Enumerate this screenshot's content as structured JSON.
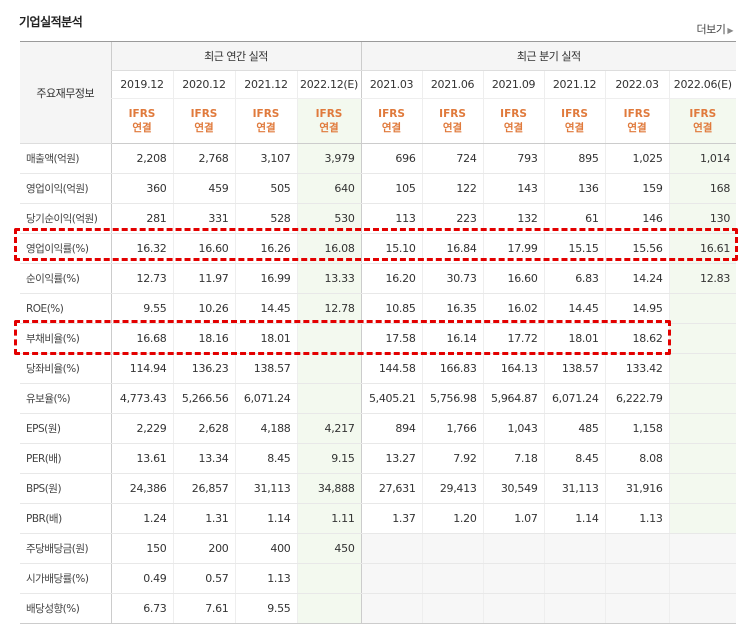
{
  "page": {
    "title": "기업실적분석",
    "more_label": "더보기"
  },
  "header": {
    "row_label": "주요재무정보",
    "annual_label": "최근 연간 실적",
    "quarter_label": "최근 분기 실적",
    "periods": [
      "2019.12",
      "2020.12",
      "2021.12",
      "2022.12(E)",
      "2021.03",
      "2021.06",
      "2021.09",
      "2021.12",
      "2022.03",
      "2022.06(E)"
    ],
    "ifrs_top": "IFRS",
    "ifrs_bottom": "연결"
  },
  "rows": [
    {
      "label": "매출액(억원)",
      "values": [
        "2,208",
        "2,768",
        "3,107",
        "3,979",
        "696",
        "724",
        "793",
        "895",
        "1,025",
        "1,014"
      ]
    },
    {
      "label": "영업이익(억원)",
      "values": [
        "360",
        "459",
        "505",
        "640",
        "105",
        "122",
        "143",
        "136",
        "159",
        "168"
      ]
    },
    {
      "label": "당기순이익(억원)",
      "values": [
        "281",
        "331",
        "528",
        "530",
        "113",
        "223",
        "132",
        "61",
        "146",
        "130"
      ]
    },
    {
      "label": "영업이익률(%)",
      "values": [
        "16.32",
        "16.60",
        "16.26",
        "16.08",
        "15.10",
        "16.84",
        "17.99",
        "15.15",
        "15.56",
        "16.61"
      ]
    },
    {
      "label": "순이익률(%)",
      "values": [
        "12.73",
        "11.97",
        "16.99",
        "13.33",
        "16.20",
        "30.73",
        "16.60",
        "6.83",
        "14.24",
        "12.83"
      ]
    },
    {
      "label": "ROE(%)",
      "values": [
        "9.55",
        "10.26",
        "14.45",
        "12.78",
        "10.85",
        "16.35",
        "16.02",
        "14.45",
        "14.95",
        ""
      ]
    },
    {
      "label": "부채비율(%)",
      "values": [
        "16.68",
        "18.16",
        "18.01",
        "",
        "17.58",
        "16.14",
        "17.72",
        "18.01",
        "18.62",
        ""
      ]
    },
    {
      "label": "당좌비율(%)",
      "values": [
        "114.94",
        "136.23",
        "138.57",
        "",
        "144.58",
        "166.83",
        "164.13",
        "138.57",
        "133.42",
        ""
      ]
    },
    {
      "label": "유보율(%)",
      "values": [
        "4,773.43",
        "5,266.56",
        "6,071.24",
        "",
        "5,405.21",
        "5,756.98",
        "5,964.87",
        "6,071.24",
        "6,222.79",
        ""
      ]
    },
    {
      "label": "EPS(원)",
      "values": [
        "2,229",
        "2,628",
        "4,188",
        "4,217",
        "894",
        "1,766",
        "1,043",
        "485",
        "1,158",
        ""
      ]
    },
    {
      "label": "PER(배)",
      "values": [
        "13.61",
        "13.34",
        "8.45",
        "9.15",
        "13.27",
        "7.92",
        "7.18",
        "8.45",
        "8.08",
        ""
      ]
    },
    {
      "label": "BPS(원)",
      "values": [
        "24,386",
        "26,857",
        "31,113",
        "34,888",
        "27,631",
        "29,413",
        "30,549",
        "31,113",
        "31,916",
        ""
      ]
    },
    {
      "label": "PBR(배)",
      "values": [
        "1.24",
        "1.31",
        "1.14",
        "1.11",
        "1.37",
        "1.20",
        "1.07",
        "1.14",
        "1.13",
        ""
      ]
    },
    {
      "label": "주당배당금(원)",
      "values": [
        "150",
        "200",
        "400",
        "450",
        "",
        "",
        "",
        "",
        "",
        ""
      ]
    },
    {
      "label": "시가배당률(%)",
      "values": [
        "0.49",
        "0.57",
        "1.13",
        "",
        "",
        "",
        "",
        "",
        "",
        ""
      ]
    },
    {
      "label": "배당성향(%)",
      "values": [
        "6.73",
        "7.61",
        "9.55",
        "",
        "",
        "",
        "",
        "",
        "",
        ""
      ]
    }
  ],
  "highlight_color": "#e30000"
}
